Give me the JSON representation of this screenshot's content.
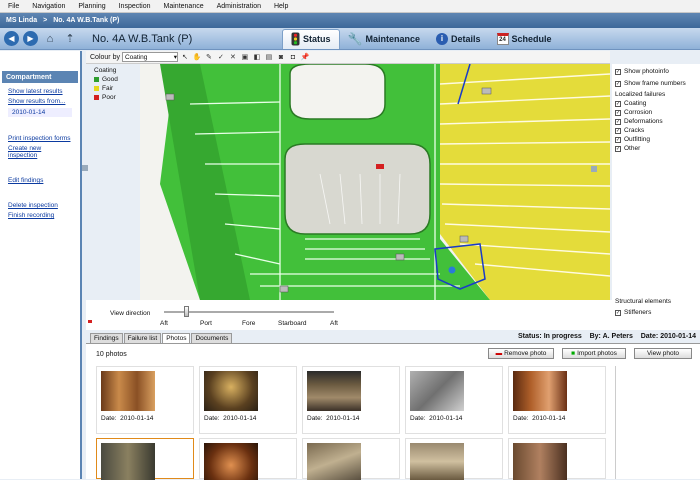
{
  "menubar": [
    "File",
    "Navigation",
    "Planning",
    "Inspection",
    "Maintenance",
    "Administration",
    "Help"
  ],
  "window": {
    "app": "MS Linda",
    "separator": ">",
    "location": "No. 4A W.B.Tank (P)"
  },
  "nav": {
    "title": "No. 4A W.B.Tank (P)",
    "tabs": [
      {
        "label": "Status",
        "icon": "traffic-light-icon",
        "active": true
      },
      {
        "label": "Maintenance",
        "icon": "wrench-icon",
        "active": false
      },
      {
        "label": "Details",
        "icon": "info-icon",
        "active": false
      },
      {
        "label": "Schedule",
        "icon": "calendar-icon",
        "active": false
      }
    ],
    "calendar_day": "24"
  },
  "sidebar": {
    "header": "Compartment",
    "links1": [
      "Show latest results",
      "Show results from..."
    ],
    "date": "2010-01-14",
    "links2": [
      "Print inspection forms",
      "Create new inspection"
    ],
    "links3": [
      "Edit findings"
    ],
    "links4": [
      "Delete inspection",
      "Finish recording"
    ]
  },
  "toolbar": {
    "colour_label": "Colour by",
    "colour_value": "Coating"
  },
  "legend": {
    "title": "Coating",
    "items": [
      {
        "label": "Good",
        "color": "#2e9e2e"
      },
      {
        "label": "Fair",
        "color": "#e6d81e"
      },
      {
        "label": "Poor",
        "color": "#d42020"
      }
    ]
  },
  "right_panel": {
    "top": [
      {
        "label": "Show photoinfo",
        "checked": true
      },
      {
        "label": "Show frame numbers",
        "checked": true
      }
    ],
    "failures_title": "Localized failures",
    "failures": [
      {
        "label": "Coating",
        "checked": true
      },
      {
        "label": "Corrosion",
        "checked": true
      },
      {
        "label": "Deformations",
        "checked": true
      },
      {
        "label": "Cracks",
        "checked": true
      },
      {
        "label": "Outfitting",
        "checked": true
      },
      {
        "label": "Other",
        "checked": true
      }
    ],
    "structural_title": "Structural elements",
    "structural": [
      {
        "label": "Stiffeners",
        "checked": true
      }
    ]
  },
  "view_direction": {
    "label": "View direction",
    "marks": [
      "Aft",
      "Port",
      "Fore",
      "Starboard",
      "Aft"
    ],
    "position": 0.12
  },
  "bottom": {
    "tabs": [
      "Findings",
      "Failure list",
      "Photos",
      "Documents"
    ],
    "active_tab": "Photos",
    "status_label": "Status:",
    "status_value": "In progress",
    "by_label": "By:",
    "by_value": "A. Peters",
    "date_label": "Date:",
    "date_value": "2010-01-14",
    "photo_count": "10 photos",
    "remove_label": "Remove photo",
    "import_label": "Import photos",
    "view_label": "View photo",
    "photos": [
      {
        "date_label": "Date:",
        "date": "2010-01-14"
      },
      {
        "date_label": "Date:",
        "date": "2010-01-14"
      },
      {
        "date_label": "Date:",
        "date": "2010-01-14"
      },
      {
        "date_label": "Date:",
        "date": "2010-01-14"
      },
      {
        "date_label": "Date:",
        "date": "2010-01-14"
      }
    ]
  }
}
